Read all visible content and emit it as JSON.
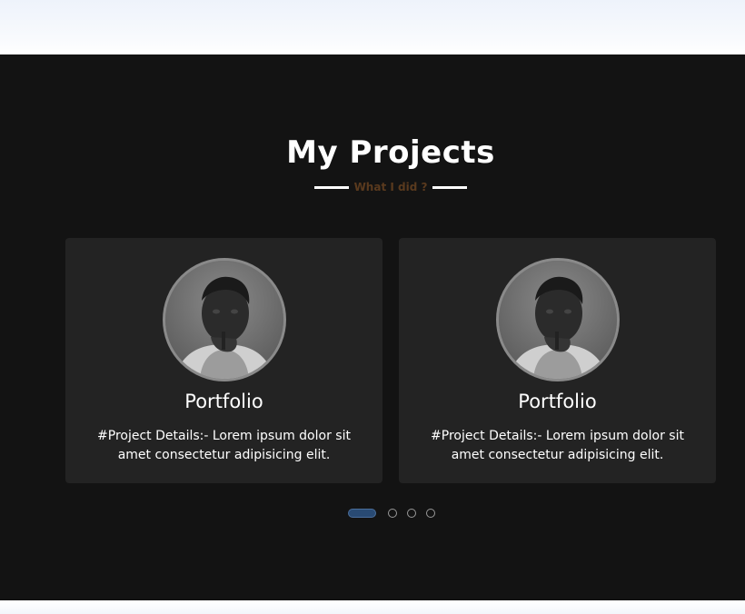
{
  "projects": {
    "title": "My Projects",
    "subtitle": "What I did ?",
    "cards": [
      {
        "title": "Portfolio",
        "description": "#Project Details:- Lorem ipsum dolor sit amet consectetur adipisicing elit."
      },
      {
        "title": "Portfolio",
        "description": "#Project Details:- Lorem ipsum dolor sit amet consectetur adipisicing elit."
      }
    ],
    "carousel": {
      "total_slides": 4,
      "active_slide": 1
    }
  }
}
